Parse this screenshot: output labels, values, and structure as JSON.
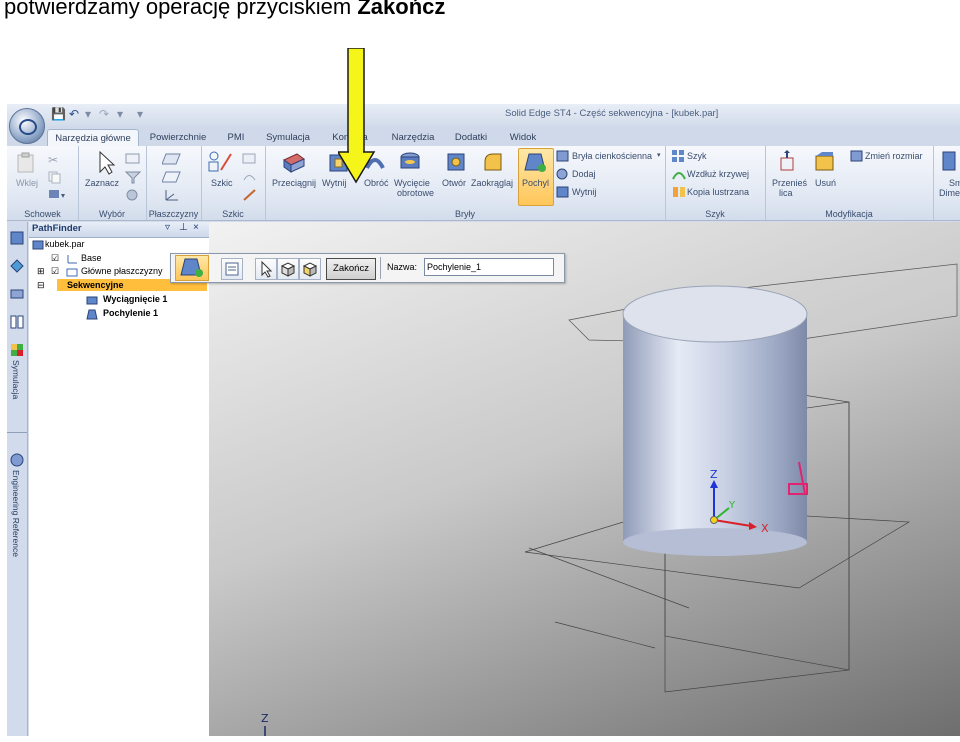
{
  "caption": {
    "prefix": "potwierdzamy operację przyciskiem ",
    "bold": "Zakończ"
  },
  "window": {
    "title": "Solid Edge ST4 - Część sekwencyjna - [kubek.par]"
  },
  "tabs": [
    {
      "label": "Narzędzia główne",
      "active": true
    },
    {
      "label": "Powierzchnie",
      "active": false
    },
    {
      "label": "PMI",
      "active": false
    },
    {
      "label": "Symulacja",
      "active": false
    },
    {
      "label": "Kontrola",
      "active": false
    },
    {
      "label": "Narzędzia",
      "active": false
    },
    {
      "label": "Dodatki",
      "active": false
    },
    {
      "label": "Widok",
      "active": false
    }
  ],
  "ribbon": {
    "schowek": {
      "group": "Schowek",
      "paste": "Wklej"
    },
    "wybor": {
      "group": "Wybór",
      "select": "Zaznacz"
    },
    "plaszczyzny": {
      "group": "Płaszczyzny"
    },
    "szkic": {
      "group": "Szkic",
      "sketch": "Szkic"
    },
    "bryly": {
      "group": "Bryły",
      "extrude": "Przeciągnij",
      "cut": "Wytnij",
      "revolve": "Obróć",
      "revolve_cut_1": "Wycięcie",
      "revolve_cut_2": "obrotowe",
      "hole": "Otwór",
      "round": "Zaokrąglaj",
      "draft": "Pochyl",
      "thinwall": "Bryła cienkościenna",
      "add": "Dodaj",
      "cut_small": "Wytnij"
    },
    "szyk": {
      "group": "Szyk",
      "pattern": "Szyk",
      "along_curve": "Wzdłuż krzywej",
      "mirror": "Kopia lustrzana"
    },
    "modyfikacja": {
      "group": "Modyfikacja",
      "move_faces_1": "Przenieś",
      "move_faces_2": "lica",
      "delete": "Usuń",
      "resize": "Zmień rozmiar"
    },
    "extra": {
      "label_1": "Sm",
      "label_2": "Dime"
    }
  },
  "pathfinder": {
    "title": "PathFinder",
    "items": [
      {
        "label": "kubek.par"
      },
      {
        "label": "Base"
      },
      {
        "label": "Główne płaszczyzny"
      },
      {
        "label": "Sekwencyjne"
      },
      {
        "label": "Wyciągnięcie 1"
      },
      {
        "label": "Pochylenie 1"
      }
    ]
  },
  "sidebar": {
    "simulation": "Symulacja",
    "engineering": "Engineering Reference"
  },
  "commandbar": {
    "finish_label": "Zakończ",
    "name_label": "Nazwa:",
    "name_value": "Pochylenie_1"
  },
  "viewport": {
    "axis_x": "X",
    "axis_y": "Y",
    "axis_z": "Z",
    "corner_axis_z": "Z"
  },
  "colors": {
    "arrow": "#f5f51a",
    "accent": "#ffd04f",
    "axis_x": "#d9202a",
    "axis_y": "#2fb52f",
    "axis_z": "#1f35d8",
    "selection": "#ffbe3c"
  }
}
